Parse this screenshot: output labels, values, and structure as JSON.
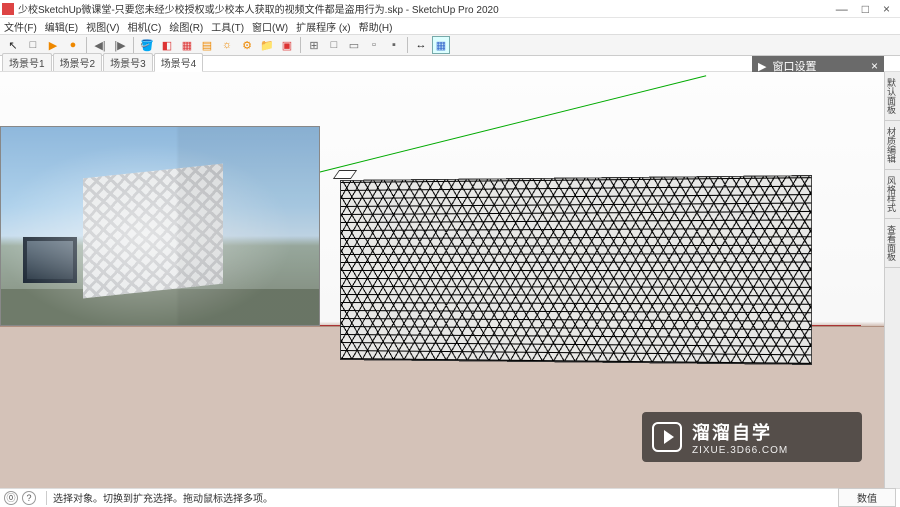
{
  "title": "少校SketchUp微课堂-只要您未经少校授权或少校本人获取的视频文件都是盗用行为.skp - SketchUp Pro 2020",
  "window_controls": {
    "min": "—",
    "max": "□",
    "close": "×"
  },
  "menus": [
    "文件(F)",
    "编辑(E)",
    "视图(V)",
    "相机(C)",
    "绘图(R)",
    "工具(T)",
    "窗口(W)",
    "扩展程序 (x)",
    "帮助(H)"
  ],
  "toolbar": {
    "icons": [
      {
        "name": "select-tool",
        "glyph": "↖",
        "cls": "c-blk"
      },
      {
        "name": "e1",
        "glyph": "□",
        "cls": "c-gry"
      },
      {
        "name": "play-icon",
        "glyph": "▶",
        "cls": "c-org"
      },
      {
        "name": "rec-icon",
        "glyph": "●",
        "cls": "c-org"
      },
      {
        "name": "sep"
      },
      {
        "name": "prev-icon",
        "glyph": "◀|",
        "cls": "c-gry"
      },
      {
        "name": "next-icon",
        "glyph": "|▶",
        "cls": "c-gry"
      },
      {
        "name": "sep"
      },
      {
        "name": "paint-icon",
        "glyph": "🪣",
        "cls": "c-red"
      },
      {
        "name": "cube-icon",
        "glyph": "◧",
        "cls": "c-red"
      },
      {
        "name": "box1-icon",
        "glyph": "▦",
        "cls": "c-red"
      },
      {
        "name": "box2-icon",
        "glyph": "▤",
        "cls": "c-org"
      },
      {
        "name": "sun-icon",
        "glyph": "☼",
        "cls": "c-org"
      },
      {
        "name": "gear-icon",
        "glyph": "⚙",
        "cls": "c-org"
      },
      {
        "name": "folder-icon",
        "glyph": "📁",
        "cls": "c-org"
      },
      {
        "name": "img-icon",
        "glyph": "▣",
        "cls": "c-red"
      },
      {
        "name": "sep"
      },
      {
        "name": "view1-icon",
        "glyph": "⊞",
        "cls": "c-gry"
      },
      {
        "name": "view2-icon",
        "glyph": "□",
        "cls": "c-gry"
      },
      {
        "name": "view3-icon",
        "glyph": "▭",
        "cls": "c-gry"
      },
      {
        "name": "view4-icon",
        "glyph": "▫",
        "cls": "c-gry"
      },
      {
        "name": "view5-icon",
        "glyph": "▪",
        "cls": "c-gry"
      },
      {
        "name": "sep"
      },
      {
        "name": "measure-icon",
        "glyph": "↔",
        "cls": "c-blk"
      },
      {
        "name": "axes-icon",
        "glyph": "▦",
        "cls": "c-blu",
        "selected": true
      }
    ]
  },
  "scene_tabs": [
    "场景号1",
    "场景号2",
    "场景号3",
    "场景号4"
  ],
  "active_scene_index": 3,
  "panel": {
    "title": "窗口设置",
    "arrow": "▶",
    "close": "×"
  },
  "right_tabs": [
    "默认面板",
    "材质编辑",
    "风格样式",
    "查看面板"
  ],
  "statusbar": {
    "hint": "选择对象。切换到扩充选择。拖动鼠标选择多项。",
    "icon1": "⓪",
    "icon2": "?",
    "right": "数值"
  },
  "watermark": {
    "big": "溜溜自学",
    "small": "ZIXUE.3D66.COM"
  }
}
